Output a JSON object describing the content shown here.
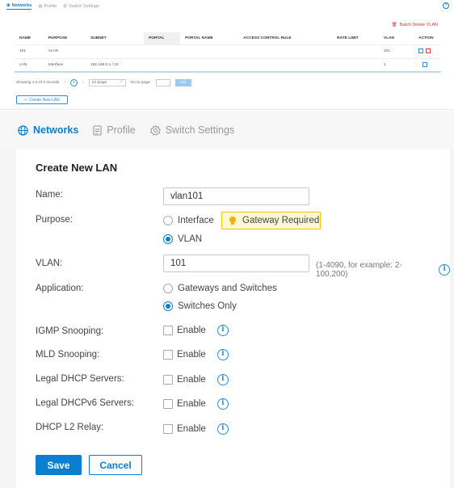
{
  "mini": {
    "tabs": [
      {
        "label": "Networks",
        "icon": "globe-icon",
        "active": true
      },
      {
        "label": "Profile",
        "icon": "document-icon",
        "active": false
      },
      {
        "label": "Switch Settings",
        "icon": "gear-icon",
        "active": false
      }
    ],
    "batch_delete_label": "Batch Delete VLAN",
    "columns": [
      "NAME",
      "PURPOSE",
      "SUBNET",
      "PORTAL",
      "PORTAL NAME",
      "ACCESS CONTROL RULE",
      "RATE LIMIT",
      "VLAN",
      "ACTION"
    ],
    "rows": [
      {
        "name": "101",
        "purpose": "VLAN",
        "subnet": "",
        "portal": "",
        "portal_name": "",
        "acl": "",
        "rate_limit": "",
        "vlan": "101"
      },
      {
        "name": "LAN",
        "purpose": "Interface",
        "subnet": "192.168.0.1 / 24",
        "portal": "",
        "portal_name": "",
        "acl": "",
        "rate_limit": "",
        "vlan": "1"
      }
    ],
    "pager": {
      "showing": "Showing 1-2 of 2 records",
      "prev": "‹",
      "page": "1",
      "next": "›",
      "page_size": "10 /page",
      "goto_label": "Go to page:",
      "go_label": "GO"
    },
    "create_label": "Create New LAN"
  },
  "tabs": [
    {
      "label": "Networks",
      "icon": "globe-icon",
      "active": true
    },
    {
      "label": "Profile",
      "icon": "document-icon",
      "active": false
    },
    {
      "label": "Switch Settings",
      "icon": "gear-icon",
      "active": false
    }
  ],
  "form": {
    "title": "Create New LAN",
    "name_label": "Name:",
    "name_value": "vlan101",
    "purpose_label": "Purpose:",
    "purpose_options": [
      {
        "label": "Interface",
        "selected": false
      },
      {
        "label": "VLAN",
        "selected": true
      }
    ],
    "gateway_badge": "Gateway Required",
    "vlan_label": "VLAN:",
    "vlan_value": "101",
    "vlan_hint": "(1-4090, for example: 2-100,200)",
    "application_label": "Application:",
    "application_options": [
      {
        "label": "Gateways and Switches",
        "selected": false
      },
      {
        "label": "Switches Only",
        "selected": true
      }
    ],
    "checkboxes": [
      {
        "label": "IGMP Snooping:",
        "option": "Enable",
        "checked": false
      },
      {
        "label": "MLD Snooping:",
        "option": "Enable",
        "checked": false
      },
      {
        "label": "Legal DHCP Servers:",
        "option": "Enable",
        "checked": false
      },
      {
        "label": "Legal DHCPv6 Servers:",
        "option": "Enable",
        "checked": false
      },
      {
        "label": "DHCP L2 Relay:",
        "option": "Enable",
        "checked": false
      }
    ],
    "save_label": "Save",
    "cancel_label": "Cancel"
  },
  "colors": {
    "accent": "#0a7ecf",
    "danger": "#e03030",
    "warning_bg": "#fff8d6",
    "warning_border": "#f0c400"
  }
}
